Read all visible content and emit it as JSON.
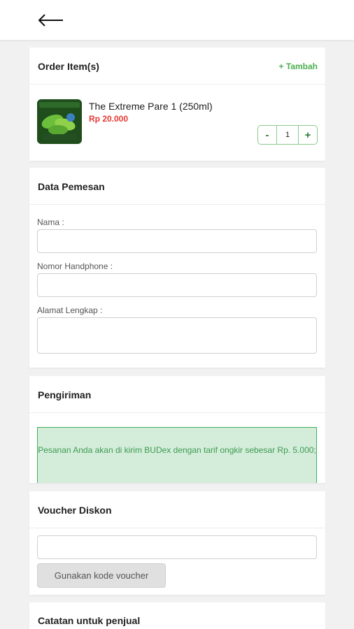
{
  "header": {
    "back_icon": "arrow-left-icon"
  },
  "order": {
    "title": "Order Item(s)",
    "add_label": "+ Tambah",
    "item": {
      "name": "The Extreme Pare 1 (250ml)",
      "price": "Rp 20.000",
      "quantity": "1",
      "minus_label": "-",
      "plus_label": "+"
    }
  },
  "data_pemesan": {
    "title": "Data Pemesan",
    "name_label": "Nama :",
    "phone_label": "Nomor Handphone :",
    "address_label": "Alamat Lengkap :"
  },
  "shipping": {
    "title": "Pengiriman",
    "message": "Pesanan Anda akan di kirim BUDex dengan tarif ongkir sebesar Rp. 5.000;"
  },
  "voucher": {
    "title": "Voucher Diskon",
    "button_label": "Gunakan kode voucher"
  },
  "notes": {
    "title": "Catatan untuk penjual"
  },
  "colors": {
    "accent": "#4caf50",
    "price": "#e53935",
    "alert_bg": "#d4edda",
    "alert_border": "#3fae5a"
  }
}
